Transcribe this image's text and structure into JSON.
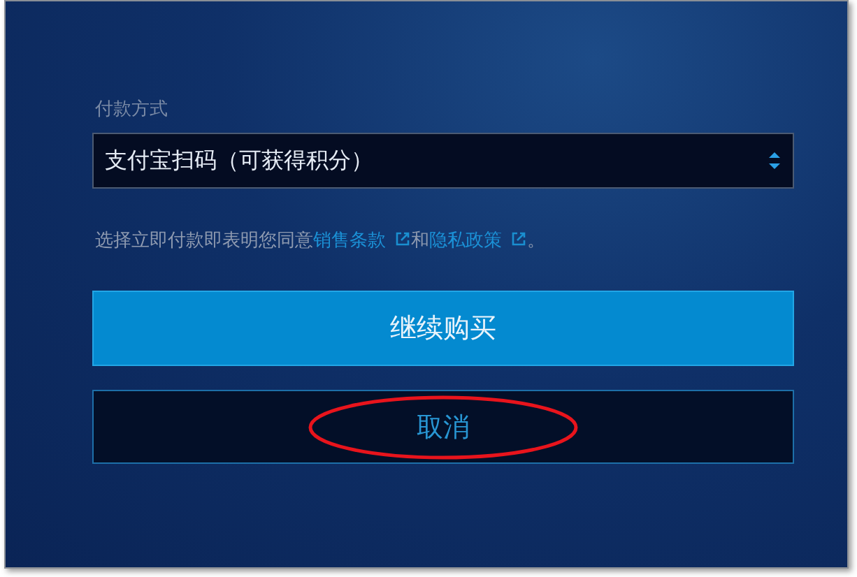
{
  "payment": {
    "label": "付款方式",
    "select": {
      "value": "支付宝扫码（可获得积分）"
    }
  },
  "consent": {
    "parts": [
      {
        "kind": "text",
        "text": "选择立即付款即表明您同意"
      },
      {
        "kind": "link",
        "text": "销售条款"
      },
      {
        "kind": "text",
        "text": "和"
      },
      {
        "kind": "link",
        "text": "隐私政策"
      },
      {
        "kind": "text",
        "text": "。"
      }
    ]
  },
  "buttons": [
    {
      "kind": "primary",
      "label": "继续购买"
    },
    {
      "kind": "secondary",
      "label": "取消"
    }
  ],
  "annotation": {
    "kind": "ellipse",
    "color": "#e8141c"
  }
}
